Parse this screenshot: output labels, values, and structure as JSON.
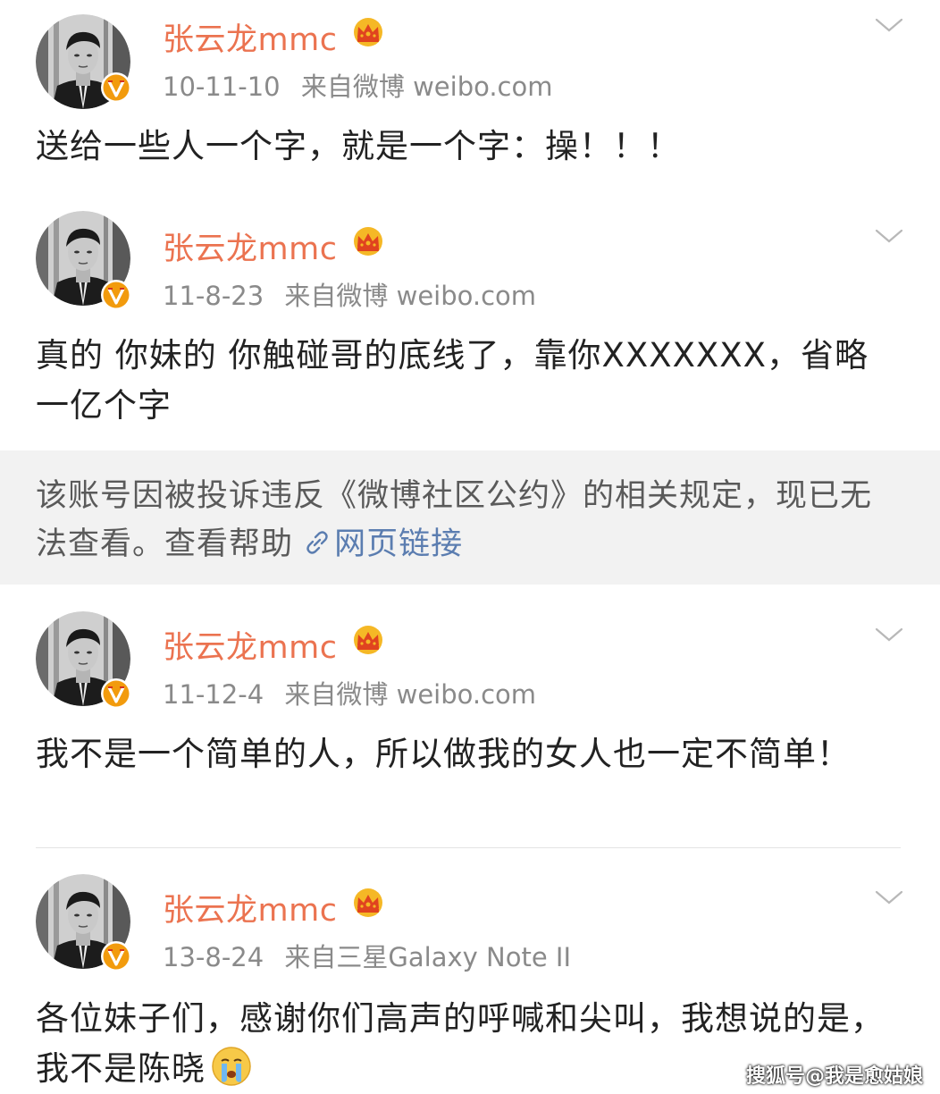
{
  "posts": [
    {
      "username": "张云龙mmc",
      "date": "10-11-10",
      "source": "来自微博 weibo.com",
      "text": "送给一些人一个字，就是一个字：操！！！"
    },
    {
      "username": "张云龙mmc",
      "date": "11-8-23",
      "source": "来自微博 weibo.com",
      "text": "真的 你妹的 你触碰哥的底线了，靠你XXXXXXX，省略一亿个字"
    },
    {
      "username": "张云龙mmc",
      "date": "11-12-4",
      "source": "来自微博 weibo.com",
      "text": "我不是一个简单的人，所以做我的女人也一定不简单！"
    },
    {
      "username": "张云龙mmc",
      "date": "13-8-24",
      "source": "来自三星Galaxy Note II",
      "text": "各位妹子们，感谢你们高声的呼喊和尖叫，我想说的是，我不是陈晓"
    }
  ],
  "notice": {
    "text": "该账号因被投诉违反《微博社区公约》的相关规定，现已无法查看。查看帮助",
    "link_label": "网页链接"
  },
  "watermark": "搜狐号@我是愈姑娘",
  "icons": {
    "avatar": "avatar-photo",
    "verified": "verified-badge-icon",
    "crown": "crown-icon",
    "chevron": "chevron-down-icon",
    "link": "link-icon",
    "emoji": "crying-emoji-icon"
  },
  "colors": {
    "username": "#eb7350",
    "meta": "#8a8a8a",
    "link": "#5b7db0",
    "notice_bg": "#f2f2f2",
    "verified": "#f29b0d"
  }
}
